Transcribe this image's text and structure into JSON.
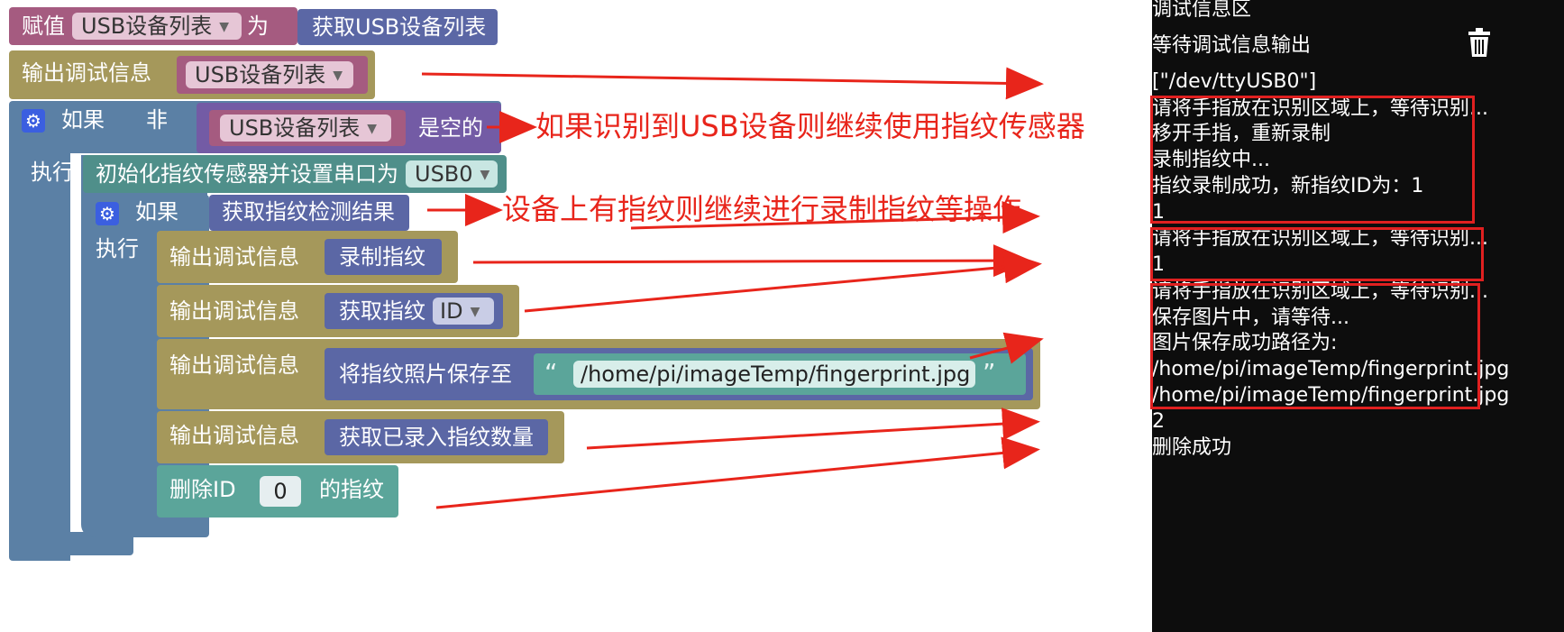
{
  "blocks": {
    "assign_label": "赋值",
    "assign_var": "USB设备列表",
    "assign_as": "为",
    "assign_value": "获取USB设备列表",
    "print_label": "输出调试信息",
    "print1_var": "USB设备列表",
    "if_label": "如果",
    "not_label": "非",
    "if_var": "USB设备列表",
    "is_empty": "是空的",
    "do_label": "执行",
    "init_label": "初始化指纹传感器并设置串口为",
    "init_port": "USB0",
    "if2_label": "如果",
    "if2_cond": "获取指纹检测结果",
    "do2_label": "执行",
    "enroll": "录制指纹",
    "get_fp": "获取指纹",
    "get_fp_opt": "ID",
    "save_photo": "将指纹照片保存至",
    "photo_path": "/home/pi/imageTemp/fingerprint.jpg",
    "count": "获取已录入指纹数量",
    "delete_prefix": "删除ID",
    "delete_id": "0",
    "delete_suffix": "的指纹"
  },
  "annotations": {
    "note1": "如果识别到USB设备则继续使用指纹传感器",
    "note2": "设备上有指纹则继续进行录制指纹等操作"
  },
  "debug": {
    "title": "调试信息区",
    "waiting": "等待调试信息输出",
    "lines": [
      "[\"/dev/ttyUSB0\"]",
      "请将手指放在识别区域上，等待识别...",
      "移开手指，重新录制",
      "录制指纹中...",
      "指纹录制成功，新指纹ID为：1",
      "1",
      "请将手指放在识别区域上，等待识别...",
      "1",
      "请将手指放在识别区域上，等待识别...",
      "保存图片中，请等待...",
      "图片保存成功路径为:",
      "/home/pi/imageTemp/fingerprint.jpg",
      "/home/pi/imageTemp/fingerprint.jpg",
      "2",
      "删除成功"
    ]
  },
  "colors": {
    "annotation": "#e8251b",
    "debug_bg": "#0d0d0d"
  },
  "icons": [
    "gear-icon",
    "trash-icon",
    "dropdown-caret-icon"
  ]
}
